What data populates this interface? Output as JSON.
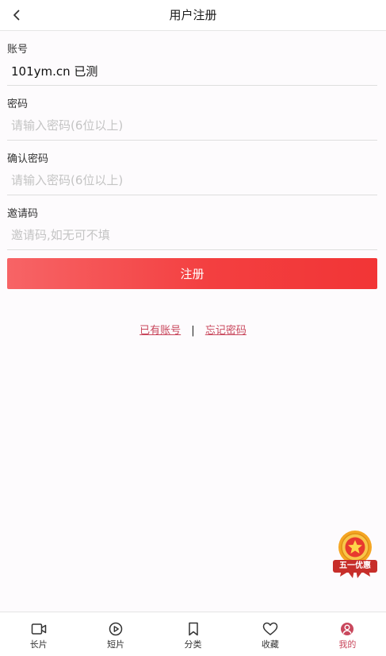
{
  "header": {
    "title": "用户注册",
    "back_icon": "chevron-left-icon"
  },
  "form": {
    "account": {
      "label": "账号",
      "value": "101ym.cn 已测",
      "placeholder": ""
    },
    "password": {
      "label": "密码",
      "value": "",
      "placeholder": "请输入密码(6位以上)"
    },
    "confirm_password": {
      "label": "确认密码",
      "value": "",
      "placeholder": "请输入密码(6位以上)"
    },
    "invite_code": {
      "label": "邀请码",
      "value": "",
      "placeholder": "邀请码,如无可不填"
    },
    "submit_label": "注册"
  },
  "links": {
    "have_account": "已有账号",
    "separator": "|",
    "forgot_password": "忘记密码"
  },
  "promo_badge": {
    "text": "五一优惠",
    "icon": "medal-star-icon"
  },
  "tabbar": {
    "items": [
      {
        "label": "长片",
        "icon": "video-camera-icon",
        "active": false
      },
      {
        "label": "短片",
        "icon": "play-circle-icon",
        "active": false
      },
      {
        "label": "分类",
        "icon": "bookmark-icon",
        "active": false
      },
      {
        "label": "收藏",
        "icon": "heart-icon",
        "active": false
      },
      {
        "label": "我的",
        "icon": "user-circle-icon",
        "active": true
      }
    ]
  },
  "colors": {
    "accent": "#f33f40",
    "link": "#c9485d",
    "background": "#fdfbfd"
  }
}
